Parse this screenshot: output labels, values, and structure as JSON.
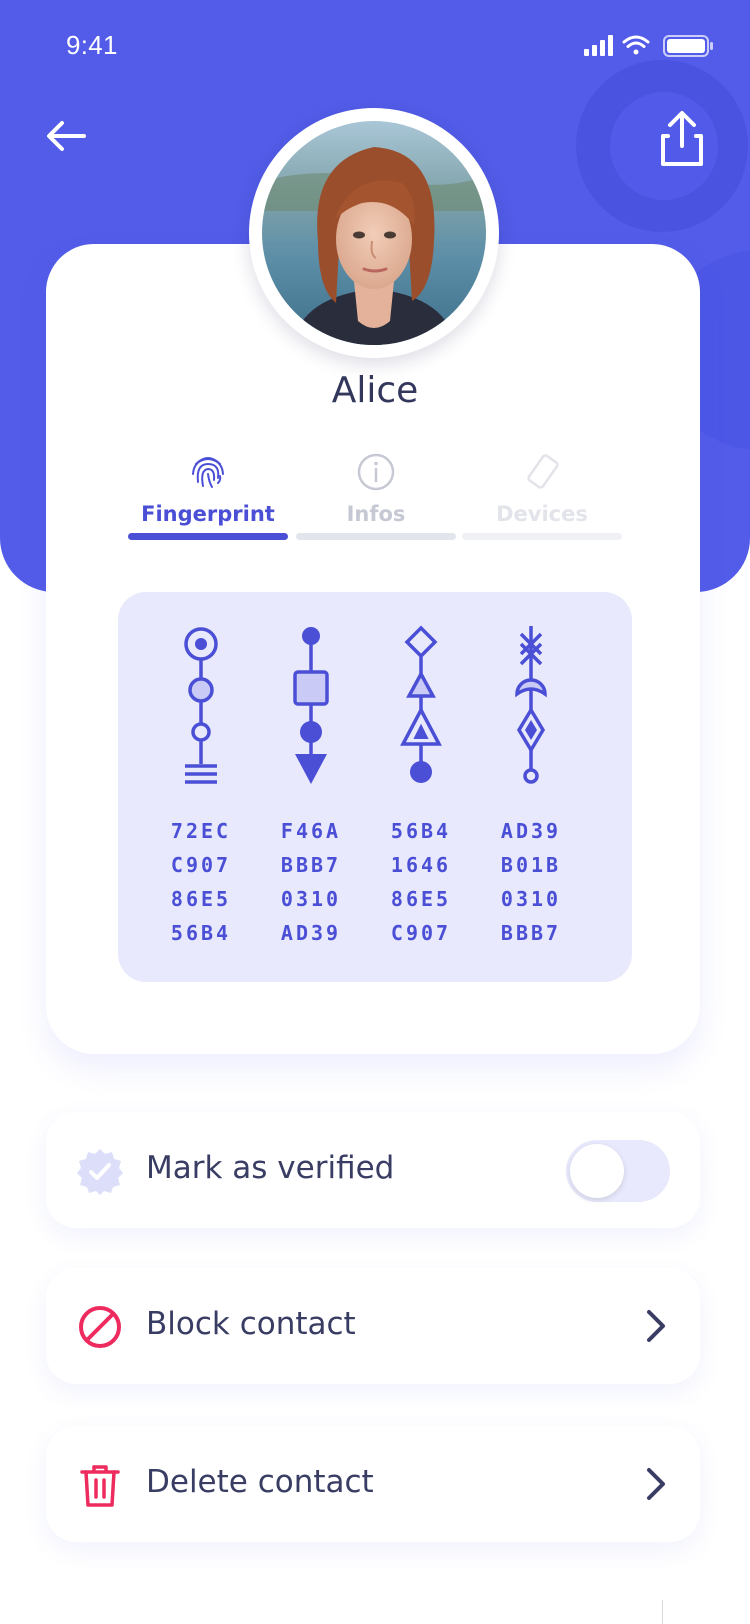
{
  "status_bar": {
    "time": "9:41",
    "icons": [
      "cellular-signal-icon",
      "wifi-icon",
      "battery-icon"
    ]
  },
  "header": {
    "back_icon": "arrow-left-icon",
    "share_icon": "share-upload-icon"
  },
  "contact": {
    "name": "Alice",
    "avatar": "profile-photo"
  },
  "tabs": [
    {
      "label": "Fingerprint",
      "icon": "fingerprint-icon",
      "active": true
    },
    {
      "label": "Infos",
      "icon": "info-icon",
      "active": false
    },
    {
      "label": "Devices",
      "icon": "device-icon",
      "active": false
    }
  ],
  "fingerprint": {
    "glyphs": [
      "glyph-circle-target",
      "glyph-square-arrow",
      "glyph-diamond-triangle",
      "glyph-cross-moon-diamond"
    ],
    "columns": [
      [
        "72EC",
        "C907",
        "86E5",
        "56B4"
      ],
      [
        "F46A",
        "BBB7",
        "0310",
        "AD39"
      ],
      [
        "56B4",
        "1646",
        "86E5",
        "C907"
      ],
      [
        "AD39",
        "B01B",
        "0310",
        "BBB7"
      ]
    ]
  },
  "actions": {
    "verify": {
      "label": "Mark as verified",
      "icon": "verified-badge-icon",
      "toggled": false
    },
    "block": {
      "label": "Block contact",
      "icon": "block-icon"
    },
    "delete": {
      "label": "Delete contact",
      "icon": "trash-icon"
    }
  },
  "colors": {
    "brand": "#525CE8",
    "accent": "#4A4FD6",
    "danger": "#EE2B5E",
    "fingerprint_bg": "#E8E9FC"
  }
}
